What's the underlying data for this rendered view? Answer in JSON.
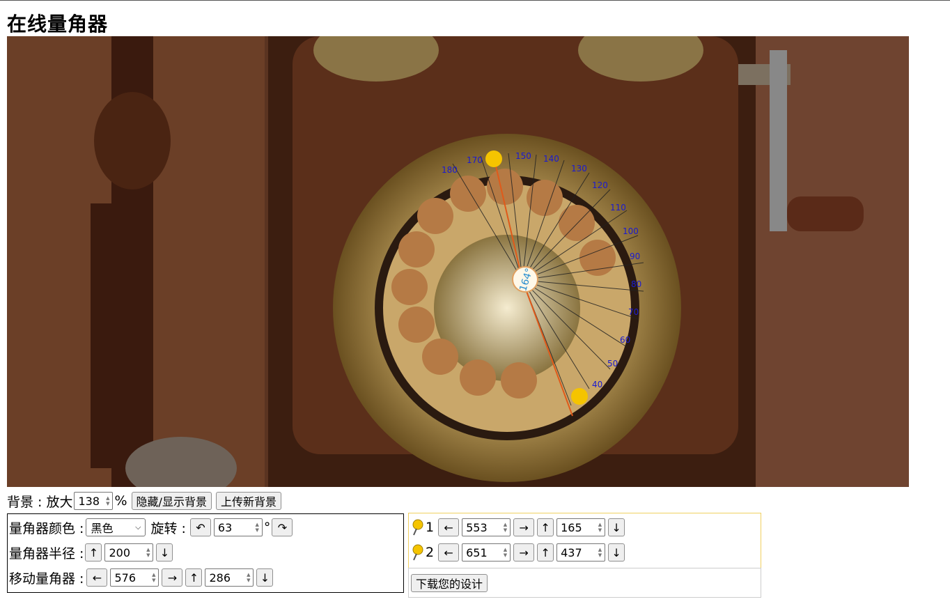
{
  "page": {
    "title": "在线量角器"
  },
  "protractor": {
    "angle_label": "164°"
  },
  "background": {
    "label": "背景 : 放大",
    "zoom": "138",
    "percent": "%",
    "toggle_label": "隐藏/显示背景",
    "upload_label": "上传新背景"
  },
  "settings": {
    "color_label": "量角器颜色 :",
    "color_value": "黑色",
    "rotate_label": "旋转 :",
    "rotate_value": "63",
    "degree_symbol": "°",
    "radius_label": "量角器半径 :",
    "radius_value": "200",
    "move_label": "移动量角器 :",
    "move_x": "576",
    "move_y": "286"
  },
  "points": [
    {
      "index": "1",
      "x": "553",
      "y": "165"
    },
    {
      "index": "2",
      "x": "651",
      "y": "437"
    }
  ],
  "arrows": {
    "left": "←",
    "right": "→",
    "up": "↑",
    "down": "↓",
    "rot_ccw": "↶",
    "rot_cw": "↷"
  },
  "download": {
    "label": "下载您的设计"
  },
  "icons": {
    "pin_color": "#f5c400",
    "protractor_line_color": "#e05a1a",
    "scale_color": "#1a1ad0"
  }
}
